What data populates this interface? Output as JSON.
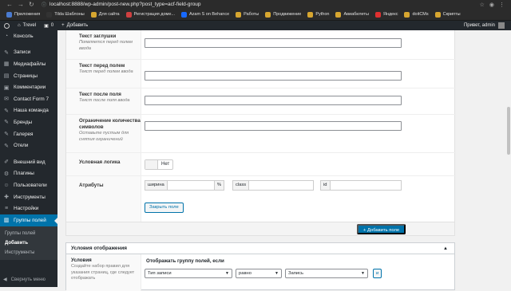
{
  "browser": {
    "url": "localhost:8888/wp-admin/post-new.php?post_type=acf-field-group",
    "bookmarks": [
      {
        "label": "Приложения",
        "color": "#4a7bd0"
      },
      {
        "label": "Tilda Шаблоны",
        "color": "#333333"
      },
      {
        "label": "Для сайта",
        "color": "#d7a630"
      },
      {
        "label": "Регистрация доме...",
        "color": "#d04040"
      },
      {
        "label": "Azam S on Behance",
        "color": "#1769ff"
      },
      {
        "label": "Работы",
        "color": "#d7a630"
      },
      {
        "label": "Продвижение",
        "color": "#d7a630"
      },
      {
        "label": "Python",
        "color": "#d7a630"
      },
      {
        "label": "Авиабилеты",
        "color": "#d7a630"
      },
      {
        "label": "Яндекс",
        "color": "#e03030"
      },
      {
        "label": "doitCMs",
        "color": "#d7a630"
      },
      {
        "label": "Скрипты",
        "color": "#d7a630"
      }
    ]
  },
  "adminbar": {
    "site": "Trevel",
    "comments": "0",
    "add": "Добавить",
    "greeting": "Привет, admin"
  },
  "sidebar": {
    "items": [
      {
        "label": "Консоль",
        "icon": "dashboard-icon"
      },
      {
        "label": "Записи",
        "icon": "pin-icon"
      },
      {
        "label": "Медиафайлы",
        "icon": "media-icon"
      },
      {
        "label": "Страницы",
        "icon": "page-icon"
      },
      {
        "label": "Комментарии",
        "icon": "comment-icon"
      },
      {
        "label": "Contact Form 7",
        "icon": "mail-icon"
      },
      {
        "label": "Наша команда",
        "icon": "pin-icon"
      },
      {
        "label": "Бренды",
        "icon": "pin-icon"
      },
      {
        "label": "Галерея",
        "icon": "pin-icon"
      },
      {
        "label": "Отели",
        "icon": "pin-icon"
      },
      {
        "label": "Внешний вид",
        "icon": "brush-icon"
      },
      {
        "label": "Плагины",
        "icon": "plugin-icon"
      },
      {
        "label": "Пользователи",
        "icon": "user-icon"
      },
      {
        "label": "Инструменты",
        "icon": "wrench-icon"
      },
      {
        "label": "Настройки",
        "icon": "settings-icon"
      },
      {
        "label": "Группы полей",
        "icon": "fields-icon"
      }
    ],
    "submenu": [
      "Группы полей",
      "Добавить",
      "Инструменты"
    ],
    "collapse": "Свернуть меню"
  },
  "fields": {
    "placeholder": {
      "title": "Текст заглушки",
      "desc": "Появляется перед полем ввода"
    },
    "prepend": {
      "title": "Текст перед полем",
      "desc": "Текст перед полем ввода"
    },
    "append": {
      "title": "Текст после поля",
      "desc": "Текст после поля ввода"
    },
    "maxlength": {
      "title": "Ограничение количества символов",
      "desc": "Оставьте пустым для снятия ограничений"
    },
    "logic": {
      "title": "Условная логика",
      "toggle": "Нет"
    },
    "attrs": {
      "title": "Атрибуты",
      "width": "ширина",
      "percent": "%",
      "class": "class",
      "id": "id"
    },
    "close_button": "Закрыть поле",
    "add_button": "+ Добавить поле"
  },
  "location": {
    "title": "Условия отображения",
    "rules_label": "Условия",
    "rules_desc": "Создайте набор правил для указания страниц, где следует отображать",
    "show_if": "Отображать группу полей, если",
    "param": "Тип записи",
    "operator": "равно",
    "value": "Запись",
    "and": "и"
  }
}
